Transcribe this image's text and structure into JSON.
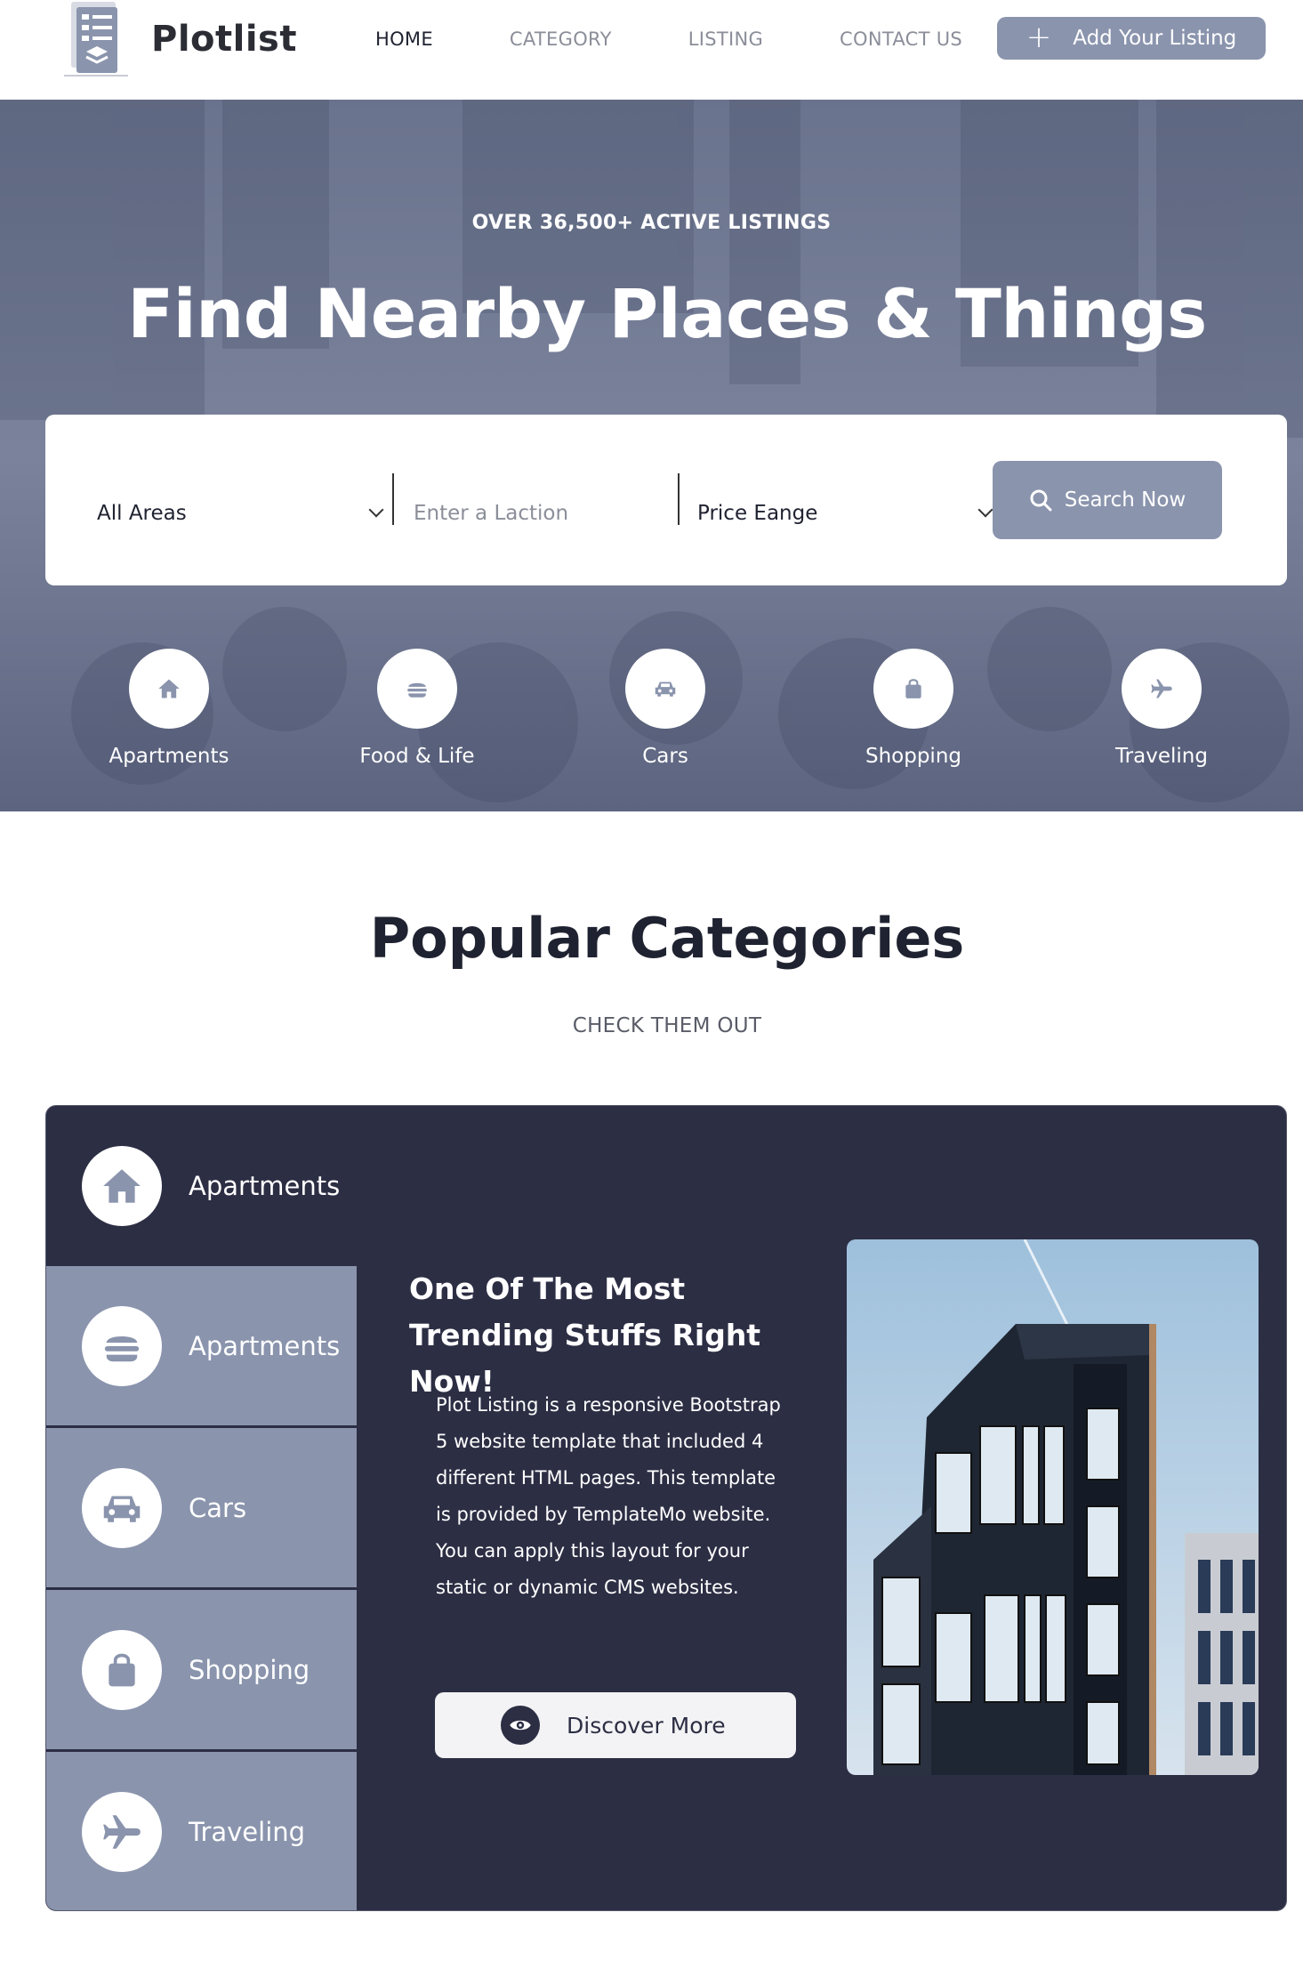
{
  "brand": {
    "name": "Plotlist"
  },
  "nav": {
    "items": [
      "HOME",
      "CATEGORY",
      "LISTING",
      "CONTACT US"
    ],
    "active": "HOME"
  },
  "add_listing": {
    "label": "Add Your Listing",
    "icon": "plus-icon"
  },
  "hero": {
    "eyebrow": "OVER 36,500+ ACTIVE LISTINGS",
    "title": "Find Nearby Places & Things"
  },
  "search": {
    "area_value": "All Areas",
    "location_placeholder": "Enter a Laction",
    "price_value": "Price Eange",
    "button_label": "Search Now"
  },
  "quick_categories": [
    {
      "label": "Apartments",
      "icon": "home-icon"
    },
    {
      "label": "Food & Life",
      "icon": "burger-icon"
    },
    {
      "label": "Cars",
      "icon": "car-icon"
    },
    {
      "label": "Shopping",
      "icon": "shopping-bag-icon"
    },
    {
      "label": "Traveling",
      "icon": "plane-icon"
    }
  ],
  "popular": {
    "title": "Popular Categories",
    "subtitle": "CHECK THEM OUT",
    "tabs": [
      {
        "label": "Apartments",
        "icon": "home-icon"
      },
      {
        "label": "Apartments",
        "icon": "burger-icon"
      },
      {
        "label": "Cars",
        "icon": "car-icon"
      },
      {
        "label": "Shopping",
        "icon": "shopping-bag-icon"
      },
      {
        "label": "Traveling",
        "icon": "plane-icon"
      }
    ],
    "content": {
      "title": "One Of The Most Trending Stuffs Right Now!",
      "description": "Plot Listing is a responsive Bootstrap 5 website template that included 4 different HTML pages. This template is provided by TemplateMo website. You can apply this layout for your static or dynamic CMS websites.",
      "button_label": "Discover More"
    }
  },
  "colors": {
    "accent": "#8a94ad",
    "panel": "#2c2e44",
    "text_dark": "#1f2230",
    "muted": "#8b8e99"
  }
}
